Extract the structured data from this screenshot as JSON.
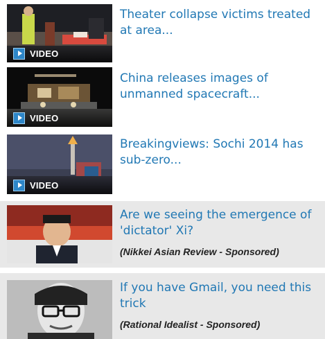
{
  "badge_label": "VIDEO",
  "accent_color": "#2178b4",
  "items": [
    {
      "kind": "video",
      "headline": "Theater collapse victims treated at area...",
      "thumbnail_icon": "rescue-scene-image"
    },
    {
      "kind": "video",
      "headline": "China releases images of unmanned spacecraft...",
      "thumbnail_icon": "lunar-rover-image"
    },
    {
      "kind": "video",
      "headline": "Breakingviews: Sochi 2014 has sub-zero...",
      "thumbnail_icon": "olympic-torch-image"
    },
    {
      "kind": "sponsored",
      "headline": "Are we seeing the emergence of 'dictator' Xi?",
      "source": "(Nikkei Asian Review - Sponsored)",
      "thumbnail_icon": "politician-portrait-image"
    },
    {
      "kind": "sponsored",
      "headline": "If you have Gmail, you need this trick",
      "source": "(Rational Idealist - Sponsored)",
      "thumbnail_icon": "man-with-glasses-portrait-image"
    }
  ]
}
